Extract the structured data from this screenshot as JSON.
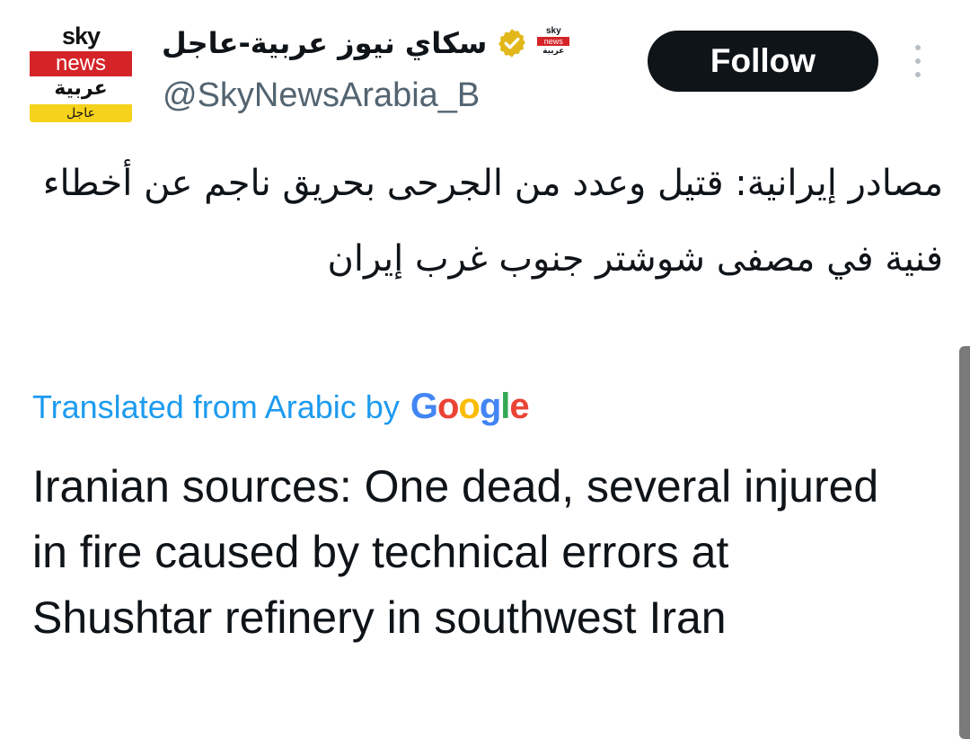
{
  "account": {
    "avatar": {
      "sky": "sky",
      "news": "news",
      "arabic": "عربية",
      "urgent": "عاجل"
    },
    "display_name": "سكاي نيوز عربية-عاجل",
    "handle": "@SkyNewsArabia_B",
    "verified_icon": "verified-badge-icon",
    "brand_colors": {
      "red": "#d42428",
      "yellow": "#f6d21c",
      "verified_gold": "#e2b719"
    }
  },
  "actions": {
    "follow_label": "Follow",
    "more_icon": "more-vertical-icon"
  },
  "post": {
    "original_text": "مصادر إيرانية: قتيل وعدد من الجرحى بحريق ناجم عن أخطاء فنية في مصفى شوشتر جنوب غرب إيران",
    "translated_label": "Translated from Arabic by",
    "translator": "Google",
    "translated_text": "Iranian sources: One dead, several injured in fire caused by technical errors at Shushtar refinery in southwest Iran"
  },
  "colors": {
    "link_blue": "#1d9bf0",
    "text": "#0f1419",
    "secondary": "#536471",
    "button_bg": "#0f1419"
  }
}
